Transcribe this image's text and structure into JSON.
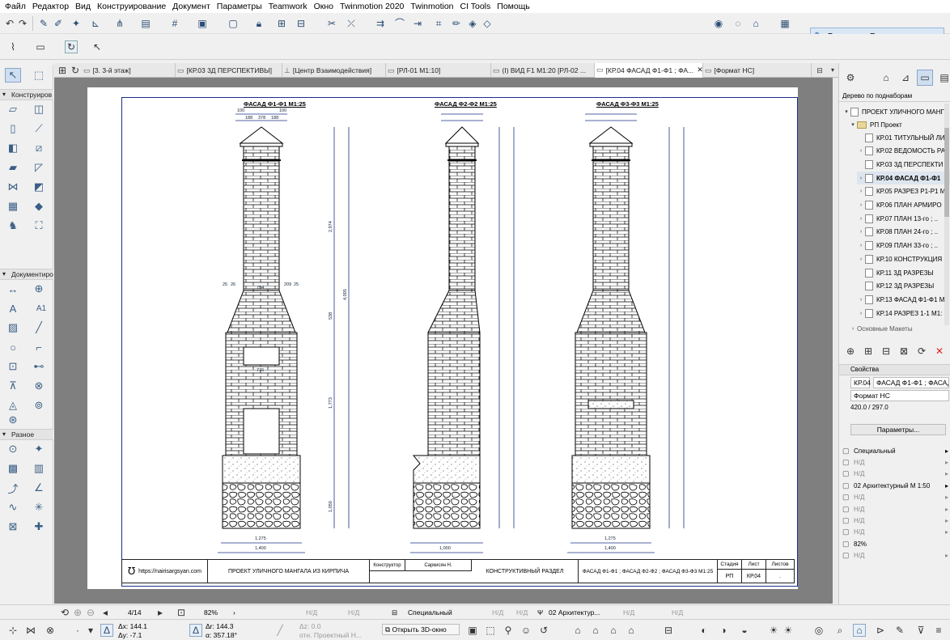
{
  "menu": [
    "Файл",
    "Редактор",
    "Вид",
    "Конструирование",
    "Документ",
    "Параметры",
    "Teamwork",
    "Окно",
    "Twinmotion 2020",
    "Twinmotion",
    "CI Tools",
    "Помощь"
  ],
  "toolbar": {
    "demolish_label": "Временно Разгрупировать"
  },
  "toolbox": {
    "sections": [
      "Конструиров",
      "Документиро",
      "Разное"
    ],
    "doc_label_icon": "A1"
  },
  "tabs": [
    {
      "label": "[3. 3-й этаж]",
      "icon": "plan-icon"
    },
    {
      "label": "[КР.03 3Д ПЕРСПЕКТИВЫ]",
      "icon": "layout-icon"
    },
    {
      "label": "[Центр Взаимодействия]",
      "icon": "tower-icon"
    },
    {
      "label": "[РЛ-01 М1:10]",
      "icon": "worksheet-icon"
    },
    {
      "label": "(I) ВИД F1 М1:20 [РЛ-02 ...",
      "icon": "elevation-icon"
    },
    {
      "label": "[КР.04 ФАСАД Ф1-Ф1 ; ФА...",
      "icon": "layout-icon",
      "active": true
    },
    {
      "label": "[Формат НС]",
      "icon": "master-icon"
    }
  ],
  "drawing": {
    "titles": [
      "ФАСАД Ф1-Ф1 М1:25",
      "ФАСАД Ф2-Ф2 М1:25",
      "ФАСАД Ф3-Ф3 М1:25"
    ],
    "dims_top": [
      "100",
      "188",
      "378",
      "188",
      "100"
    ],
    "dims_bottom_1": [
      "1,275",
      "1,400"
    ],
    "dims_bottom_2": [
      "1,000"
    ],
    "dims_bottom_3": [
      "1,275",
      "1,400"
    ],
    "dims_side": [
      "2,974",
      "4,005",
      "538",
      "1,773",
      "1,050"
    ],
    "dims_mid": [
      "25",
      "26",
      "754",
      "209",
      "25"
    ],
    "opening_label": "776"
  },
  "titleblock": {
    "website": "https://nairisargsyan.com",
    "project": "ПРОЕКТ УЛИЧНОГО МАНГАЛА ИЗ КИРПИЧА",
    "role_label": "Конструктор",
    "author": "Саркисян Н.",
    "section": "КОНСТРУКТИВНЫЙ РАЗДЕЛ",
    "sheet_title": "ФАСАД Ф1-Ф1 ; ФАСАД Ф2-Ф2 ; ФАСАД Ф3-Ф3 М1:25",
    "stage_label": "Стадия",
    "sheet_label": "Лист",
    "sheets_label": "Листов",
    "stage": "РП",
    "sheet": "КР.04",
    "sheets": "."
  },
  "navigator": {
    "header": "Дерево по поднаборам",
    "root": "ПРОЕКТ УЛИЧНОГО МАНГ",
    "subset": "РП Проект",
    "items": [
      {
        "label": "КР.01 ТИТУЛЬНЫЙ ЛИ",
        "expand": false
      },
      {
        "label": "КР.02 ВЕДОМОСТЬ РА",
        "expand": true
      },
      {
        "label": "КР.03 3Д ПЕРСПЕКТИ",
        "expand": false
      },
      {
        "label": "КР.04 ФАСАД Ф1-Ф1",
        "expand": true,
        "selected": true
      },
      {
        "label": "КР.05 РАЗРЕЗ Р1-Р1 М",
        "expand": true
      },
      {
        "label": "КР.06 ПЛАН АРМИРО",
        "expand": true
      },
      {
        "label": "КР.07  ПЛАН 13-го ; ..",
        "expand": true
      },
      {
        "label": "КР.08  ПЛАН 24-го ; ..",
        "expand": true
      },
      {
        "label": "КР.09  ПЛАН 33-го ; ..",
        "expand": true
      },
      {
        "label": "КР.10 КОНСТРУКЦИЯ",
        "expand": true
      },
      {
        "label": "КР.11 3Д РАЗРЕЗЫ",
        "expand": false
      },
      {
        "label": "КР.12 3Д РАЗРЕЗЫ",
        "expand": false
      },
      {
        "label": "КР.13 ФАСАД Ф1-Ф1 М",
        "expand": true
      },
      {
        "label": "КР.14 РАЗРЕЗ 1-1 М1:",
        "expand": true
      }
    ],
    "hidden_item": "Основные Макеты"
  },
  "properties": {
    "header": "Свойства",
    "id": "КР.04",
    "name": "ФАСАД Ф1-Ф1 ; ФАСАД",
    "master": "Формат НС",
    "size": "420.0 / 297.0",
    "params_button": "Параметры...",
    "rows": [
      {
        "label": "Специальный",
        "na": false,
        "arrow": true
      },
      {
        "label": "Н/Д",
        "na": true,
        "arrow": true
      },
      {
        "label": "Н/Д",
        "na": true,
        "arrow": true
      },
      {
        "label": "02 Архитектурный М 1:50",
        "na": false,
        "arrow": true
      },
      {
        "label": "Н/Д",
        "na": true,
        "arrow": true
      },
      {
        "label": "Н/Д",
        "na": true,
        "arrow": true
      },
      {
        "label": "Н/Д",
        "na": true,
        "arrow": true
      },
      {
        "label": "Н/Д",
        "na": true,
        "arrow": true
      },
      {
        "label": "82%",
        "na": false,
        "arrow": false
      },
      {
        "label": "Н/Д",
        "na": true,
        "arrow": true
      }
    ]
  },
  "statusbar": {
    "page": "4/14",
    "zoom": "82%",
    "na1": "Н/Д",
    "na2": "Н/Д",
    "layer": "Специальный",
    "na3": "Н/Д",
    "na4": "Н/Д",
    "penset": "02 Архитектур...",
    "na5": "Н/Д",
    "na6": "Н/Д"
  },
  "infobar": {
    "dx": "Δx: 144.1",
    "dy": "Δy: -7.1",
    "dr": "Δr: 144.3",
    "da": "α: 357.18°",
    "dz": "Δz: 0.0",
    "ref": "отн. Проектный Н...",
    "open3d": "Открыть 3D-окно"
  }
}
